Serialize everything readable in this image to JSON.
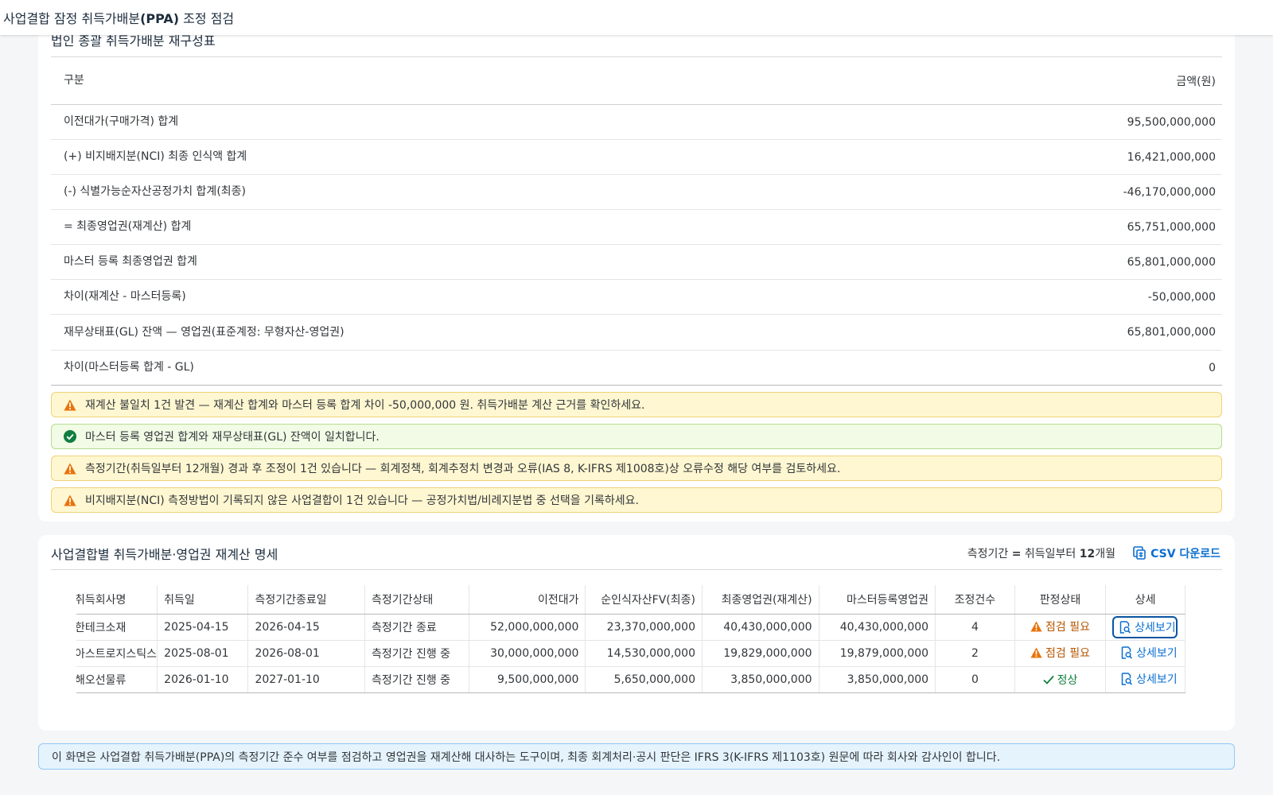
{
  "app": {
    "title_prefix": "사업결합 잠정 취득가배분",
    "title_bold": "(PPA)",
    "title_suffix": " 조정 점검"
  },
  "summary_card": {
    "title": "법인 종괄 취득가배분 재구성표",
    "col_label": "구분",
    "col_amount": "금액(원)",
    "rows": [
      {
        "label": "이전대가(구매가격) 합계",
        "amount": "95,500,000,000"
      },
      {
        "label": "(+) 비지배지분(NCI) 최종 인식액 합계",
        "amount": "16,421,000,000"
      },
      {
        "label": "(-) 식별가능순자산공정가치 합계(최종)",
        "amount": "-46,170,000,000"
      },
      {
        "label": "= 최종영업권(재계산) 합계",
        "amount": "65,751,000,000"
      },
      {
        "label": "마스터 등록 최종영업권 합계",
        "amount": "65,801,000,000"
      },
      {
        "label": "차이(재계산 - 마스터등록)",
        "amount": "-50,000,000"
      },
      {
        "label": "재무상태표(GL) 잔액 — 영업권(표준계정: 무형자산-영업권)",
        "amount": "65,801,000,000"
      },
      {
        "label": "차이(마스터등록 합계 - GL)",
        "amount": "0"
      }
    ],
    "messages": [
      {
        "type": "warning",
        "text": "재계산 불일치 1건 발견 — 재계산 합계와 마스터 등록 합계 차이 -50,000,000 원. 취득가배분 계산 근거를 확인하세요."
      },
      {
        "type": "success",
        "text": "마스터 등록 영업권 합계와 재무상태표(GL) 잔액이 일치합니다."
      },
      {
        "type": "warning",
        "text": "측정기간(취득일부터 12개월) 경과 후 조정이 1건 있습니다 — 회계정책, 회계추정치 변경과 오류(IAS 8, K-IFRS 제1008호)상 오류수정 해당 여부를 검토하세요."
      },
      {
        "type": "warning",
        "text": "비지배지분(NCI) 측정방법이 기록되지 않은 사업결합이 1건 있습니다 — 공정가치법/비례지분법 중 선택을 기록하세요."
      }
    ]
  },
  "detail_card": {
    "title": "사업결합별 취득가배분·영업권 재계산 명세",
    "period_prefix": "측정기간 ",
    "period_eq": "=",
    "period_mid": " 취득일부터 ",
    "period_num": "12",
    "period_suffix": "개월",
    "csv_label": "CSV 다운로드",
    "columns": [
      "취득회사명",
      "취득일",
      "측정기간종료일",
      "측정기간상태",
      "이전대가",
      "순인식자산FV(최종)",
      "최종영업권(재계산)",
      "마스터등록영업권",
      "조정건수",
      "판정상태",
      "상세"
    ],
    "rows": [
      {
        "company": "한테크소재",
        "acq_date": "2025-04-15",
        "period_end": "2026-04-15",
        "period_status": "측정기간 종료",
        "status_tone": "normal",
        "consideration": "52,000,000,000",
        "net_assets": "23,370,000,000",
        "goodwill_recalc": "40,430,000,000",
        "goodwill_master": "40,430,000,000",
        "master_tone": "normal",
        "adjustments": "4",
        "verdict": "점검 필요",
        "verdict_tone": "warning",
        "detail": "상세보기"
      },
      {
        "company": "아스트로지스틱스",
        "acq_date": "2025-08-01",
        "period_end": "2026-08-01",
        "period_status": "측정기간 진행 중",
        "status_tone": "green",
        "consideration": "30,000,000,000",
        "net_assets": "14,530,000,000",
        "goodwill_recalc": "19,829,000,000",
        "goodwill_master": "19,879,000,000",
        "master_tone": "orange",
        "adjustments": "2",
        "verdict": "점검 필요",
        "verdict_tone": "warning",
        "detail": "상세보기"
      },
      {
        "company": "해오선물류",
        "acq_date": "2026-01-10",
        "period_end": "2027-01-10",
        "period_status": "측정기간 진행 중",
        "status_tone": "green",
        "consideration": "9,500,000,000",
        "net_assets": "5,650,000,000",
        "goodwill_recalc": "3,850,000,000",
        "goodwill_master": "3,850,000,000",
        "master_tone": "normal",
        "adjustments": "0",
        "verdict": "정상",
        "verdict_tone": "success",
        "detail": "상세보기"
      }
    ]
  },
  "footer_note": "이 화면은 사업결합 취득가배분(PPA)의 측정기간 준수 여부를 점검하고 영업권을 재계산해 대사하는 도구이며, 최종 회계처리·공시 판단은 IFRS 3(K-IFRS 제1103호) 원문에 따라 회사와 감사인이 합니다.",
  "colors": {
    "warning": "#e9730c",
    "success": "#107e3e",
    "link": "#0a6ed1",
    "orange_text": "#b85600"
  }
}
